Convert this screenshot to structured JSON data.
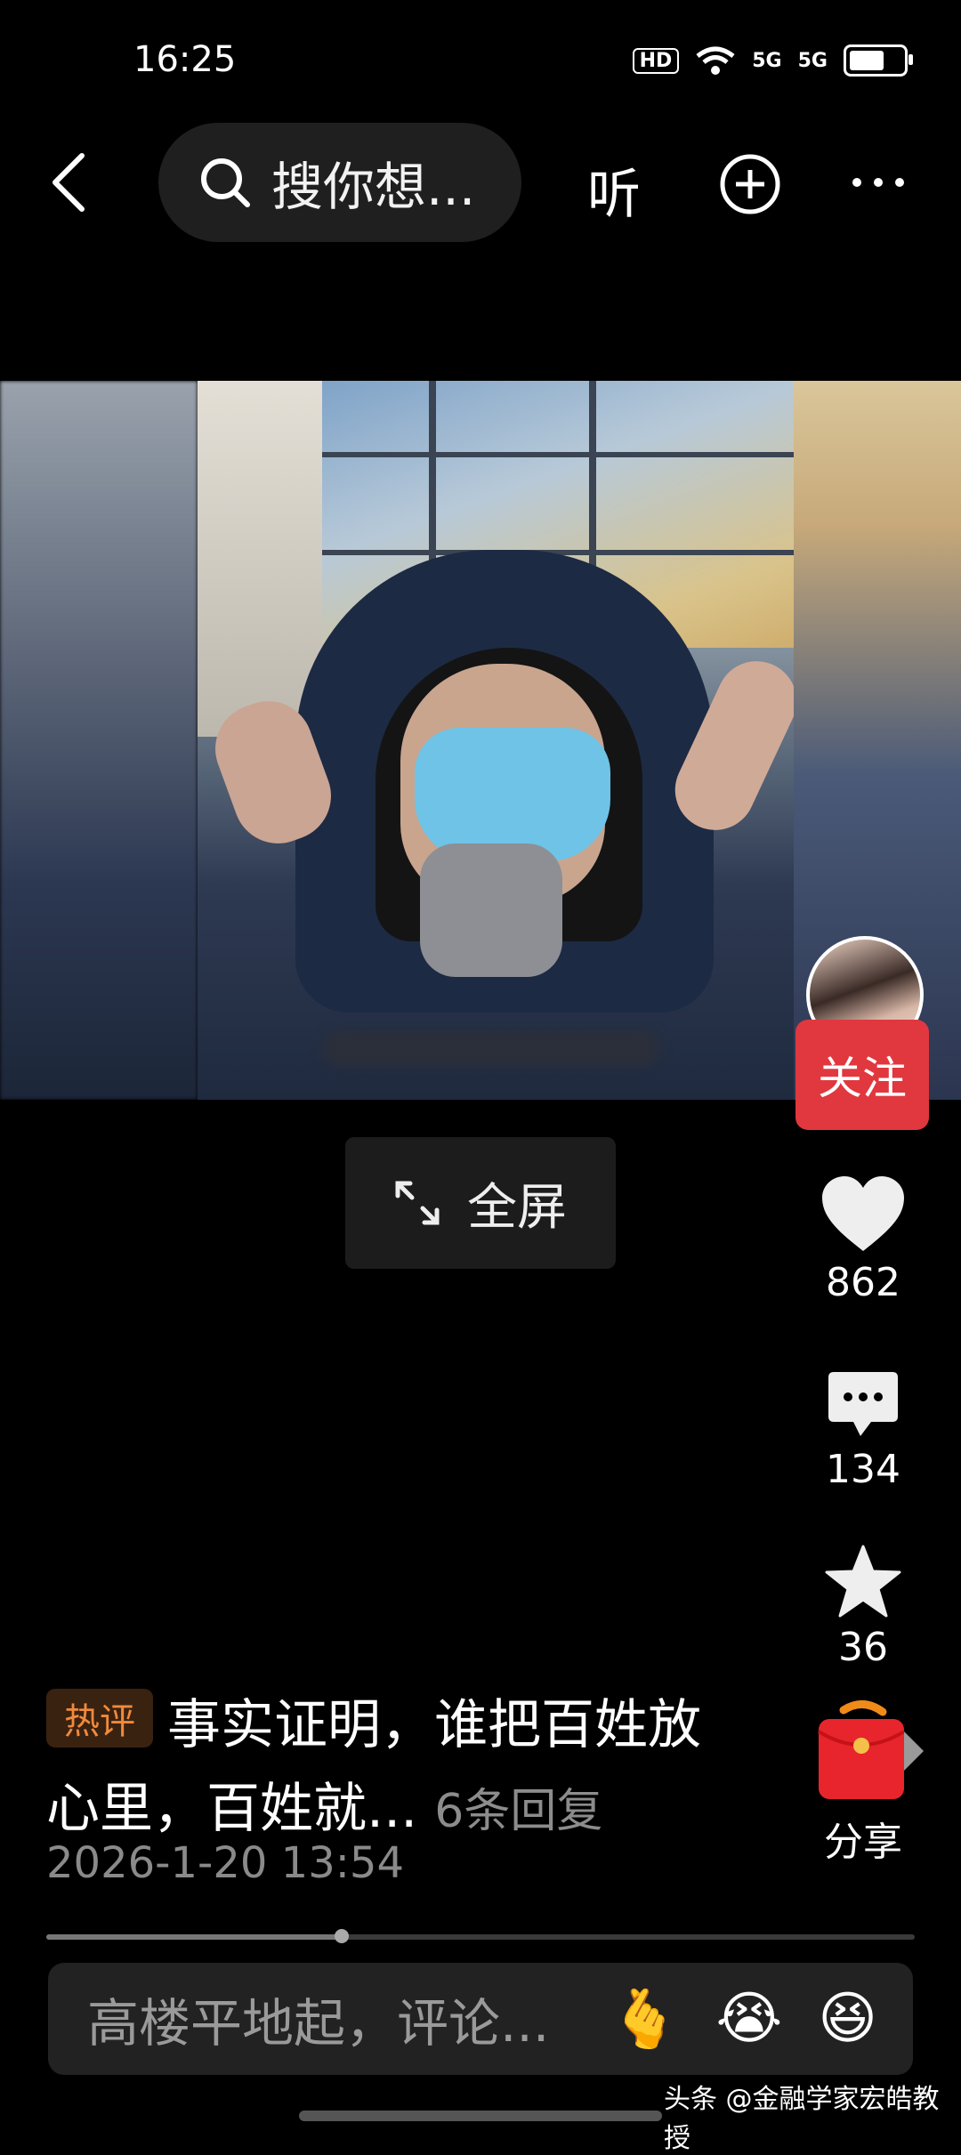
{
  "status": {
    "time": "16:25",
    "hd": "HD",
    "signal1": "5G",
    "signal2": "5G",
    "battery_level": 0.7
  },
  "nav": {
    "search_text": "搜你想...",
    "listen": "听"
  },
  "fullscreen": {
    "label": "全屏"
  },
  "author": {
    "follow": "关注"
  },
  "stats": {
    "likes": "862",
    "comments": "134",
    "favorites": "36",
    "share": "分享"
  },
  "hot_comment": {
    "badge": "热评",
    "line1": "事实证明，谁把百姓放",
    "line2": "心里，百姓就...",
    "replies": "6条回复",
    "time": "2026-1-20 13:54"
  },
  "progress": {
    "played_fraction": 0.34
  },
  "input": {
    "placeholder": "高楼平地起，评论...",
    "emojis": [
      "🫰",
      "😭",
      "😆"
    ]
  },
  "watermark": "头条 @金融学家宏皓教授",
  "colors": {
    "follow": "#e0383e",
    "hot_badge": "#f08a3c",
    "background": "#000000"
  }
}
